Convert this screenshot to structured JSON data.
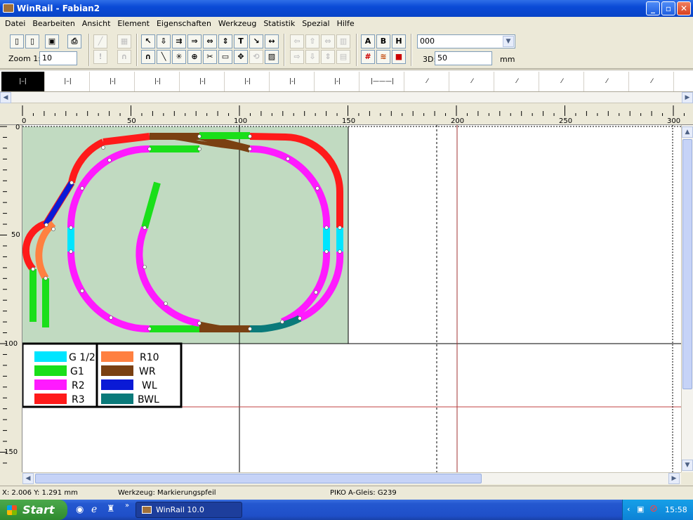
{
  "window": {
    "title": "WinRail - Fabian2",
    "min": "_",
    "max": "▫",
    "close": "✕"
  },
  "menu": [
    "Datei",
    "Bearbeiten",
    "Ansicht",
    "Element",
    "Eigenschaften",
    "Werkzeug",
    "Statistik",
    "Spezial",
    "Hilfe"
  ],
  "toolbar": {
    "zoom_label": "Zoom 1:",
    "zoom_value": "10",
    "layer_value": "000",
    "three_d_label": "3D:",
    "three_d_value": "50",
    "unit": "mm",
    "text_buttons": [
      "A",
      "B",
      "H"
    ]
  },
  "ruler": {
    "top_labels": [
      "0",
      "50",
      "100",
      "150",
      "200",
      "250",
      "300"
    ],
    "left_labels": [
      "0",
      "50",
      "100",
      "150"
    ]
  },
  "legend": {
    "left": [
      {
        "label": "G 1/2",
        "color": "#00e5ff"
      },
      {
        "label": "G1",
        "color": "#1adf1a"
      },
      {
        "label": "R2",
        "color": "#ff1aff"
      },
      {
        "label": "R3",
        "color": "#ff1a1a"
      }
    ],
    "right": [
      {
        "label": "R10",
        "color": "#ff8040"
      },
      {
        "label": "WR",
        "color": "#7a4012"
      },
      {
        "label": "WL",
        "color": "#0a1ad6"
      },
      {
        "label": "BWL",
        "color": "#0a7a7a"
      }
    ]
  },
  "status": {
    "coords": "X: 2.006   Y: 1.291 mm",
    "tool": "Werkzeug: Markierungspfeil",
    "track": "PIKO A-Gleis: G239"
  },
  "taskbar": {
    "start": "Start",
    "task": "WinRail 10.0",
    "clock": "15:58"
  }
}
